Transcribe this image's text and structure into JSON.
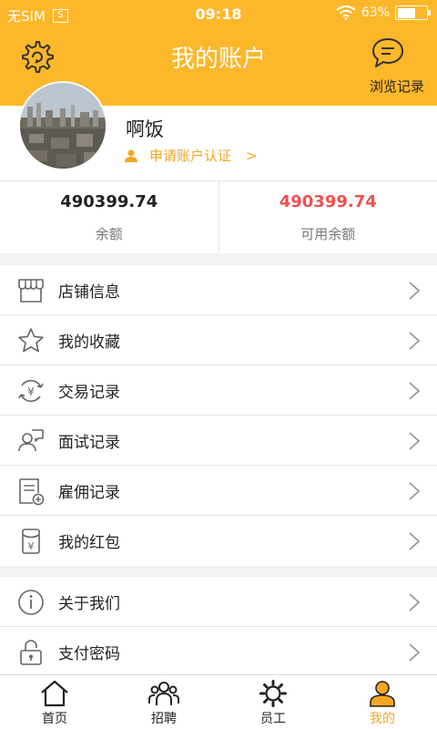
{
  "status_bar": {
    "carrier": "无SIM",
    "sim_icon_text": "S",
    "time": "09:18",
    "battery_percent": "63%",
    "battery_level": 0.63
  },
  "header": {
    "title": "我的账户",
    "history_label": "浏览记录",
    "accent_color": "#fdb72a"
  },
  "profile": {
    "username": "啊饭",
    "verify_label": "申请账户认证",
    "verify_chevron": ">"
  },
  "balance": {
    "total_amount": "490399.74",
    "total_label": "余额",
    "available_amount": "490399.74",
    "available_label": "可用余额",
    "available_color": "#f0504b"
  },
  "menu_group_1": [
    {
      "label": "店铺信息",
      "icon": "store-icon"
    },
    {
      "label": "我的收藏",
      "icon": "star-icon"
    },
    {
      "label": "交易记录",
      "icon": "transaction-icon"
    },
    {
      "label": "面试记录",
      "icon": "interview-icon"
    },
    {
      "label": "雇佣记录",
      "icon": "employment-icon"
    },
    {
      "label": "我的红包",
      "icon": "red-packet-icon"
    }
  ],
  "menu_group_2": [
    {
      "label": "关于我们",
      "icon": "info-icon"
    },
    {
      "label": "支付密码",
      "icon": "lock-icon"
    }
  ],
  "tabbar": [
    {
      "label": "首页",
      "icon": "home-icon",
      "active": false
    },
    {
      "label": "招聘",
      "icon": "recruit-icon",
      "active": false
    },
    {
      "label": "员工",
      "icon": "employee-gear-icon",
      "active": false
    },
    {
      "label": "我的",
      "icon": "profile-icon",
      "active": true
    }
  ]
}
